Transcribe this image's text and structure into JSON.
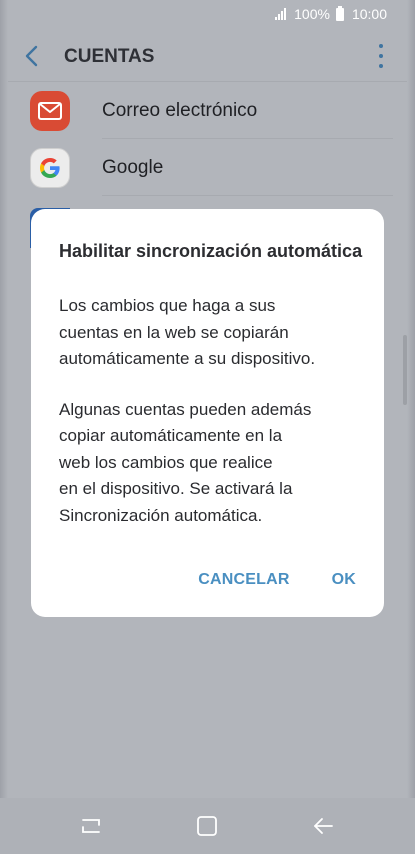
{
  "status_bar": {
    "battery_percent": "100%",
    "time": "10:00"
  },
  "app_bar": {
    "title": "CUENTAS",
    "icons": [
      "back-icon",
      "more-icon"
    ]
  },
  "accounts": [
    {
      "label": "Correo electrónico",
      "icon": "email-icon"
    },
    {
      "label": "Google",
      "icon": "google-icon"
    }
  ],
  "dialog": {
    "title": "Habilitar sincronización automática",
    "paragraph1": "Los cambios que haga a sus\ncuentas en la web se copiarán\nautomáticamente a su dispositivo.",
    "paragraph2": "Algunas cuentas pueden además\ncopiar automáticamente en la\nweb los cambios que realice\nen el dispositivo. Se activará la\nSincronización automática.",
    "cancel_label": "CANCELAR",
    "ok_label": "OK"
  },
  "colors": {
    "accent": "#4a8fc1",
    "scrim": "#b2b5bb",
    "email_icon_bg": "#d94b34"
  }
}
